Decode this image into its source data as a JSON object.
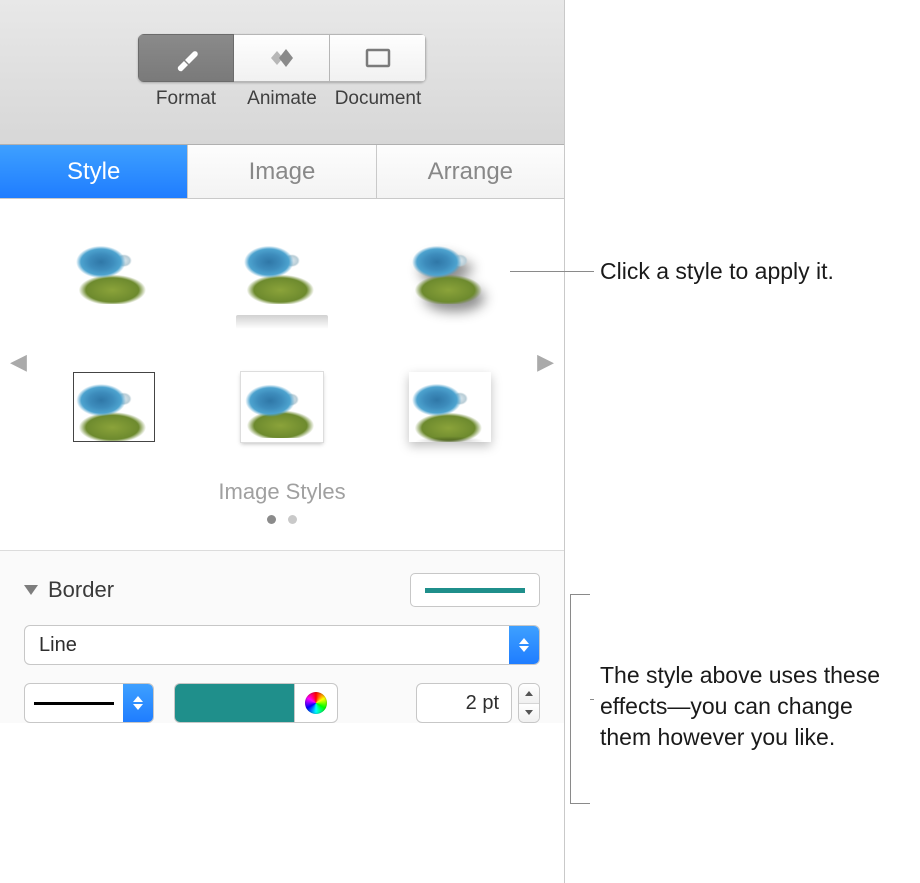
{
  "toolbar": {
    "items": [
      {
        "label": "Format",
        "icon": "paintbrush-icon",
        "active": true
      },
      {
        "label": "Animate",
        "icon": "diamond-icon",
        "active": false
      },
      {
        "label": "Document",
        "icon": "rectangle-icon",
        "active": false
      }
    ]
  },
  "tabs": {
    "items": [
      {
        "label": "Style",
        "active": true
      },
      {
        "label": "Image",
        "active": false
      },
      {
        "label": "Arrange",
        "active": false
      }
    ]
  },
  "style_grid": {
    "caption": "Image Styles",
    "page_count": 2,
    "active_page": 0
  },
  "border": {
    "section_label": "Border",
    "type_label": "Line",
    "size_value": "2 pt",
    "color": "#1f8f8b"
  },
  "callouts": {
    "thumb": "Click a style to apply it.",
    "effects": "The style above uses these effects—you can change them however you like."
  }
}
